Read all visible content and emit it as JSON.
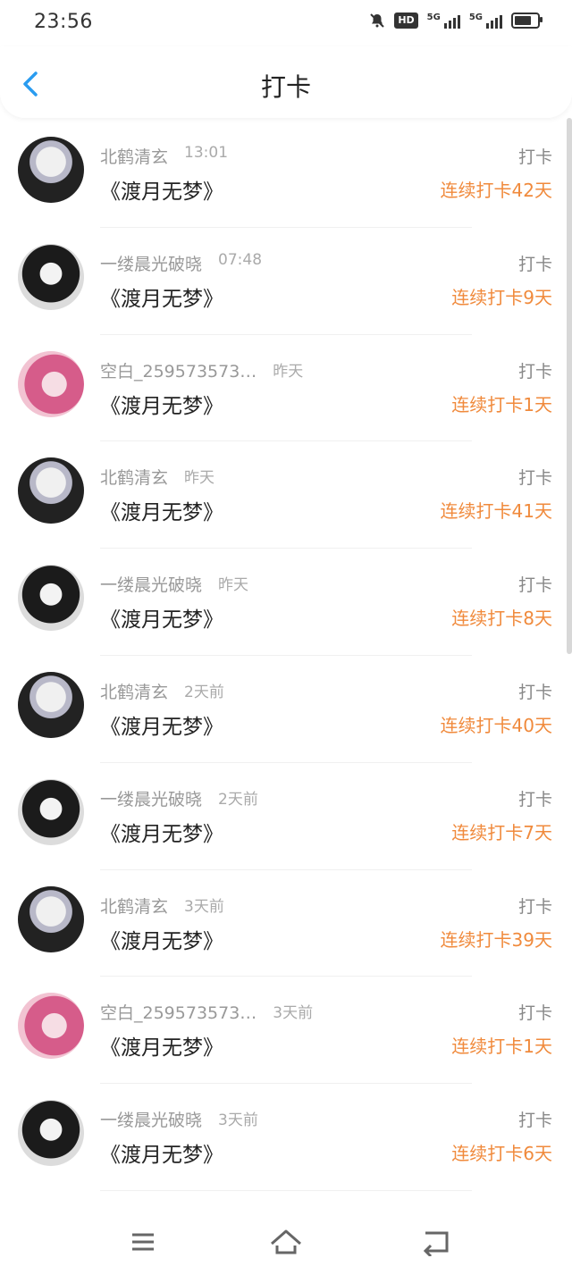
{
  "status_bar": {
    "time": "23:56",
    "network_1": "5G",
    "network_2": "5G",
    "hd_label": "HD"
  },
  "header": {
    "title": "打卡"
  },
  "rows": [
    {
      "name": "北鹤清玄",
      "time": "13:01",
      "book": "《渡月无梦》",
      "type": "打卡",
      "streak": "连续打卡42天",
      "avatar": "a"
    },
    {
      "name": "一缕晨光破晓",
      "time": "07:48",
      "book": "《渡月无梦》",
      "type": "打卡",
      "streak": "连续打卡9天",
      "avatar": "b"
    },
    {
      "name": "空白_259573573…",
      "time": "昨天",
      "book": "《渡月无梦》",
      "type": "打卡",
      "streak": "连续打卡1天",
      "avatar": "c"
    },
    {
      "name": "北鹤清玄",
      "time": "昨天",
      "book": "《渡月无梦》",
      "type": "打卡",
      "streak": "连续打卡41天",
      "avatar": "a"
    },
    {
      "name": "一缕晨光破晓",
      "time": "昨天",
      "book": "《渡月无梦》",
      "type": "打卡",
      "streak": "连续打卡8天",
      "avatar": "b"
    },
    {
      "name": "北鹤清玄",
      "time": "2天前",
      "book": "《渡月无梦》",
      "type": "打卡",
      "streak": "连续打卡40天",
      "avatar": "a"
    },
    {
      "name": "一缕晨光破晓",
      "time": "2天前",
      "book": "《渡月无梦》",
      "type": "打卡",
      "streak": "连续打卡7天",
      "avatar": "b"
    },
    {
      "name": "北鹤清玄",
      "time": "3天前",
      "book": "《渡月无梦》",
      "type": "打卡",
      "streak": "连续打卡39天",
      "avatar": "a"
    },
    {
      "name": "空白_259573573…",
      "time": "3天前",
      "book": "《渡月无梦》",
      "type": "打卡",
      "streak": "连续打卡1天",
      "avatar": "c"
    },
    {
      "name": "一缕晨光破晓",
      "time": "3天前",
      "book": "《渡月无梦》",
      "type": "打卡",
      "streak": "连续打卡6天",
      "avatar": "b"
    }
  ],
  "colors": {
    "accent": "#2a9cf0",
    "streak": "#f08a3c"
  },
  "icons": {
    "back": "chevron-left-icon",
    "menu": "menu-icon",
    "home": "home-icon",
    "return": "return-icon"
  }
}
